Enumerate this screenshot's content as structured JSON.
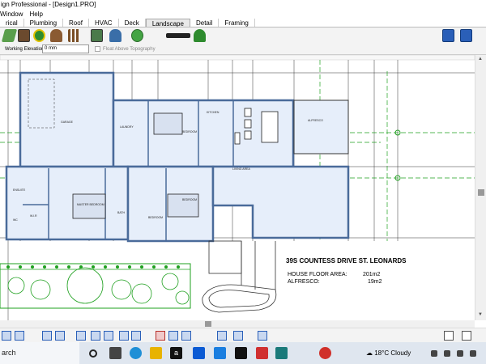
{
  "window": {
    "title": "ign Professional - [Design1.PRO]"
  },
  "menu": {
    "items": [
      "Window",
      "Help"
    ]
  },
  "tabs": [
    {
      "label": "rical",
      "active": false
    },
    {
      "label": "Plumbing",
      "active": false
    },
    {
      "label": "Roof",
      "active": false
    },
    {
      "label": "HVAC",
      "active": false
    },
    {
      "label": "Deck",
      "active": false
    },
    {
      "label": "Landscape",
      "active": true
    },
    {
      "label": "Detail",
      "active": false
    },
    {
      "label": "Framing",
      "active": false
    }
  ],
  "toolbar": {
    "icons": [
      "terrain-tool-icon",
      "cabinet-tool-icon",
      "plant-library-icon",
      "rock-tool-icon",
      "fence-tool-icon",
      "pond-tool-icon",
      "sprinkler-tool-icon",
      "garden-bed-tool-icon",
      "light-tool-icon",
      "tree-tool-icon"
    ],
    "right_icons": [
      "view-2d-icon",
      "view-3d-icon"
    ]
  },
  "options": {
    "working_elevation_label": "Working Elevation",
    "working_elevation_value": "0 mm",
    "float_label": "Float Above Topography"
  },
  "plan": {
    "address": "39S COUNTESS DRIVE ST. LEONARDS",
    "house_floor_area_label": "HOUSE FLOOR AREA:",
    "house_floor_area_value": "201m2",
    "alfresco_label": "ALFRESCO:",
    "alfresco_value": "19m2",
    "room_labels": {
      "alfresco": "ALFRESCO",
      "garage": "GARAGE",
      "laundry": "LAUNDRY",
      "master": "MASTER BEDROOM",
      "bedroom1": "BEDROOM",
      "bedroom2": "BEDROOM",
      "bedroom3": "BEDROOM",
      "living": "LIVING AREA",
      "kitchen": "KITCHEN",
      "bath": "BATH",
      "ensuite": "ENSUITE",
      "wc": "WC",
      "wir": "W.I.R"
    }
  },
  "bottom_toolbar": {
    "icons": [
      "align-left-icon",
      "align-center-icon",
      "align-right-icon",
      "distribute-icon",
      "group-icon",
      "ungroup-icon",
      "reverse-icon",
      "mirror-icon",
      "rotate-icon",
      "flip-icon",
      "move-front-icon",
      "move-back-icon",
      "sort-icon",
      "filter-icon",
      "hourglass-icon"
    ]
  },
  "taskbar": {
    "search_text": "arch",
    "weather_temp": "18°C",
    "weather_desc": "Cloudy"
  }
}
